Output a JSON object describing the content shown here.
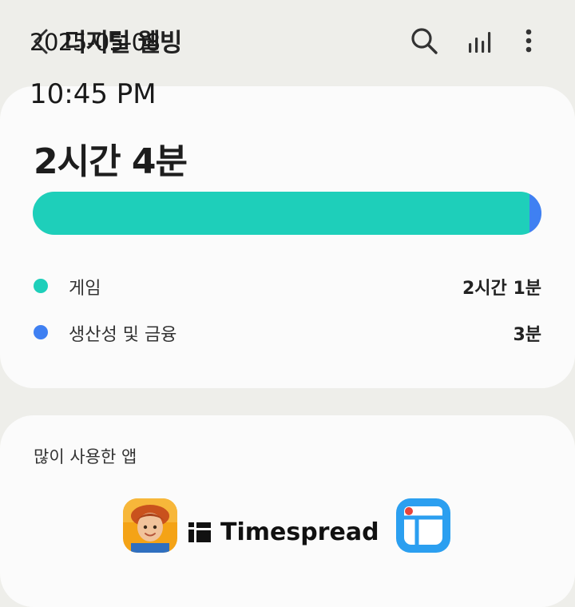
{
  "status_bar": {
    "date": "2025-05-08",
    "time": "10:45 PM"
  },
  "header": {
    "title": "디지털 웰빙",
    "back_icon": "back-arrow-icon",
    "search_icon": "search-icon",
    "stats_icon": "bar-chart-icon",
    "more_icon": "more-vertical-icon"
  },
  "summary": {
    "total_time": "2시간 4분",
    "usage_breakdown": [
      {
        "label": "게임",
        "value": "2시간 1분",
        "minutes": 121,
        "color": "#1ecfba"
      },
      {
        "label": "생산성 및 금융",
        "value": "3분",
        "minutes": 3,
        "color": "#3f80f2"
      }
    ]
  },
  "most_used": {
    "title": "많이 사용한 앱",
    "apps": [
      {
        "icon": "game-character-app-icon"
      },
      {
        "icon": "calendar-app-icon"
      }
    ]
  },
  "watermark": {
    "text": "Timespread",
    "icon": "timespread-logo-icon"
  }
}
